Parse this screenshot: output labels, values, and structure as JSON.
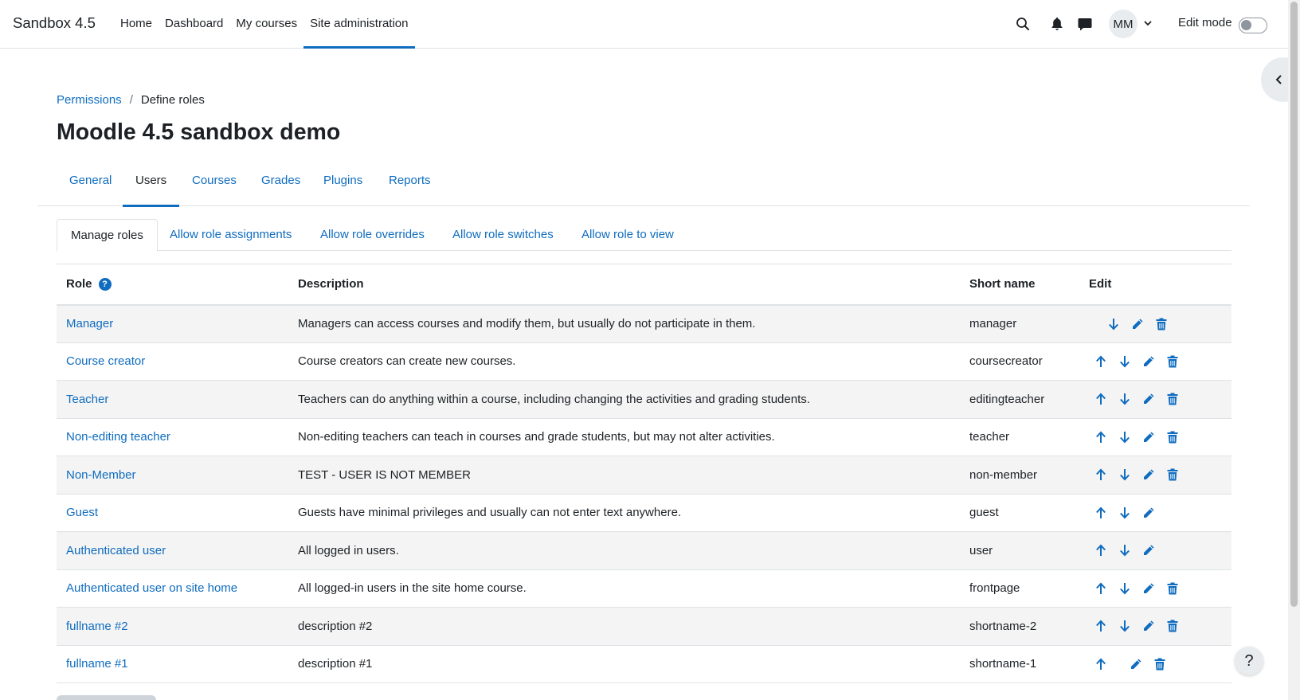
{
  "brand": "Sandbox 4.5",
  "primary_nav": [
    {
      "label": "Home"
    },
    {
      "label": "Dashboard"
    },
    {
      "label": "My courses"
    },
    {
      "label": "Site administration",
      "active": true
    }
  ],
  "user": {
    "initials": "MM"
  },
  "edit_mode": {
    "label": "Edit mode",
    "enabled": false
  },
  "breadcrumb": {
    "items": [
      "Permissions",
      "Define roles"
    ],
    "separator": "/"
  },
  "page_title": "Moodle 4.5 sandbox demo",
  "secondary_tabs": [
    {
      "label": "General"
    },
    {
      "label": "Users",
      "active": true
    },
    {
      "label": "Courses"
    },
    {
      "label": "Grades"
    },
    {
      "label": "Plugins"
    },
    {
      "label": "Reports"
    }
  ],
  "sub_tabs": [
    {
      "label": "Manage roles",
      "active": true
    },
    {
      "label": "Allow role assignments"
    },
    {
      "label": "Allow role overrides"
    },
    {
      "label": "Allow role switches"
    },
    {
      "label": "Allow role to view"
    }
  ],
  "table": {
    "headers": {
      "role": "Role",
      "description": "Description",
      "short_name": "Short name",
      "edit": "Edit"
    },
    "help_icon": "question-circle-icon",
    "rows": [
      {
        "role": "Manager",
        "description": "Managers can access courses and modify them, but usually do not participate in them.",
        "short_name": "manager",
        "actions": [
          "down",
          "edit",
          "delete"
        ]
      },
      {
        "role": "Course creator",
        "description": "Course creators can create new courses.",
        "short_name": "coursecreator",
        "actions": [
          "up",
          "down",
          "edit",
          "delete"
        ]
      },
      {
        "role": "Teacher",
        "description": "Teachers can do anything within a course, including changing the activities and grading students.",
        "short_name": "editingteacher",
        "actions": [
          "up",
          "down",
          "edit",
          "delete"
        ]
      },
      {
        "role": "Non-editing teacher",
        "description": "Non-editing teachers can teach in courses and grade students, but may not alter activities.",
        "short_name": "teacher",
        "actions": [
          "up",
          "down",
          "edit",
          "delete"
        ]
      },
      {
        "role": "Non-Member",
        "description": "TEST - USER IS NOT MEMBER",
        "short_name": "non-member",
        "actions": [
          "up",
          "down",
          "edit",
          "delete"
        ]
      },
      {
        "role": "Guest",
        "description": "Guests have minimal privileges and usually can not enter text anywhere.",
        "short_name": "guest",
        "actions": [
          "up",
          "down",
          "edit"
        ]
      },
      {
        "role": "Authenticated user",
        "description": "All logged in users.",
        "short_name": "user",
        "actions": [
          "up",
          "down",
          "edit"
        ]
      },
      {
        "role": "Authenticated user on site home",
        "description": "All logged-in users in the site home course.",
        "short_name": "frontpage",
        "actions": [
          "up",
          "down",
          "edit",
          "delete"
        ]
      },
      {
        "role": "fullname #2",
        "description": "description #2",
        "short_name": "shortname-2",
        "actions": [
          "up",
          "down",
          "edit",
          "delete"
        ]
      },
      {
        "role": "fullname #1",
        "description": "description #1",
        "short_name": "shortname-1",
        "actions": [
          "up",
          "edit",
          "delete"
        ]
      }
    ]
  },
  "help_button": "?",
  "colors": {
    "link": "#0f6cbf",
    "text": "#1d2125",
    "stripe": "#f4f4f4",
    "border": "#dee2e6"
  }
}
